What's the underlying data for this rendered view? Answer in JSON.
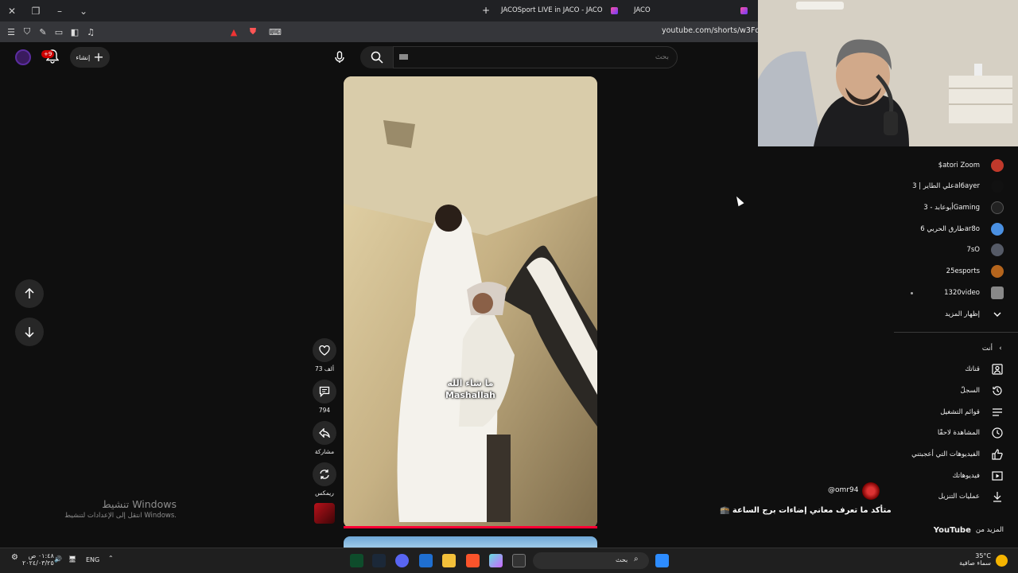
{
  "browser": {
    "tabs": [
      {
        "label": "JACOSport LIVE in JACO - JACO"
      },
      {
        "label": "JACO"
      }
    ],
    "url": "youtube.com/shorts/w3FdL9i"
  },
  "header": {
    "create_label": "إنشاء",
    "notifications_badge": "+9",
    "search_placeholder": "بحث"
  },
  "short": {
    "caption_ar": "ما شاء الله",
    "caption_en": "Mashallah",
    "likes": "73 ألف",
    "comments": "794",
    "share_label": "مشاركة",
    "remix_label": "ريمكس",
    "channel_handle": "@omr94",
    "title": "متأكد ما تعرف معاني إضاءات برج الساعة 🕋"
  },
  "sidebar": {
    "subscriptions": [
      {
        "name": "$atori Zoom",
        "color": "#c0392b"
      },
      {
        "name": "علي الطاير | 3al6ayer",
        "color": "#111111"
      },
      {
        "name": "أبوعابد - 3Gaming",
        "color": "#222222"
      },
      {
        "name": "طارق الحربي 6ar8o",
        "color": "#4a90e2"
      },
      {
        "name": "7sO",
        "color": "#555a66"
      },
      {
        "name": "25esports",
        "color": "#b5651d"
      },
      {
        "name": "1320video",
        "color": "#888888"
      }
    ],
    "show_more": "إظهار المزيد",
    "you_header": "أنت",
    "you_items": [
      {
        "label": "قناتك",
        "icon": "person-icon"
      },
      {
        "label": "السجلّ",
        "icon": "history-icon"
      },
      {
        "label": "قوائم التشغيل",
        "icon": "playlist-icon"
      },
      {
        "label": "المشاهدة لاحقًا",
        "icon": "clock-icon"
      },
      {
        "label": "الفيديوهات التي أعجبتني",
        "icon": "thumbs-up-icon"
      },
      {
        "label": "فيديوهاتك",
        "icon": "play-box-icon"
      },
      {
        "label": "عمليات التنزيل",
        "icon": "download-icon"
      }
    ],
    "more_from": "المزيد من",
    "more_from_brand": "YouTube"
  },
  "watermark": {
    "line1": "تنشيط Windows",
    "line2": "انتقل إلى الإعدادات لتنشيط Windows."
  },
  "taskbar": {
    "weather_temp": "35°C",
    "weather_text": "سماء صافية",
    "search_placeholder": "بحث",
    "language": "ENG",
    "time": "٠١:٤٨ ص",
    "date": "٢٠٢٤/٠٣/٢٥"
  },
  "colors": {
    "background": "#0f0f0f",
    "accent_red": "#ff0033"
  }
}
